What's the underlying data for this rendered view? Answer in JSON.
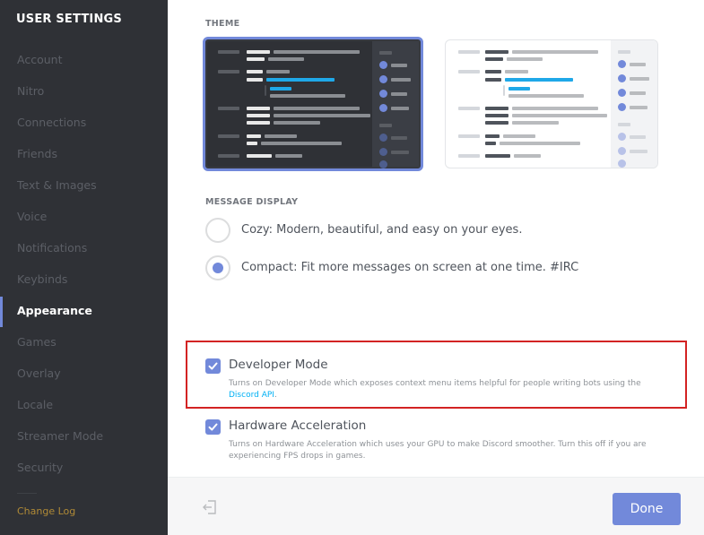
{
  "sidebar": {
    "header": "USER SETTINGS",
    "items": [
      {
        "label": "Account"
      },
      {
        "label": "Nitro"
      },
      {
        "label": "Connections"
      },
      {
        "label": "Friends"
      },
      {
        "label": "Text & Images"
      },
      {
        "label": "Voice"
      },
      {
        "label": "Notifications"
      },
      {
        "label": "Keybinds"
      },
      {
        "label": "Appearance",
        "active": true
      },
      {
        "label": "Games"
      },
      {
        "label": "Overlay"
      },
      {
        "label": "Locale"
      },
      {
        "label": "Streamer Mode"
      },
      {
        "label": "Security"
      }
    ],
    "changelog": "Change Log"
  },
  "theme": {
    "label": "THEME",
    "options": [
      {
        "name": "dark",
        "selected": true
      },
      {
        "name": "light",
        "selected": false
      }
    ]
  },
  "message_display": {
    "label": "MESSAGE DISPLAY",
    "options": [
      {
        "label": "Cozy: Modern, beautiful, and easy on your eyes.",
        "selected": false
      },
      {
        "label": "Compact: Fit more messages on screen at one time. #IRC",
        "selected": true
      }
    ]
  },
  "developer_mode": {
    "title": "Developer Mode",
    "checked": true,
    "description": "Turns on Developer Mode which exposes context menu items helpful for people writing bots using the",
    "link_text": "Discord API",
    "suffix": "."
  },
  "hardware_acceleration": {
    "title": "Hardware Acceleration",
    "checked": true,
    "description": "Turns on Hardware Acceleration which uses your GPU to make Discord smoother. Turn this off if you are experiencing FPS drops in games."
  },
  "footer": {
    "done_label": "Done",
    "logout_icon": "logout-icon"
  },
  "colors": {
    "accent": "#7289da",
    "sidebar_bg": "#2f3136",
    "highlight": "#d32323",
    "link": "#00b0f4",
    "changelog": "#b08a36"
  }
}
